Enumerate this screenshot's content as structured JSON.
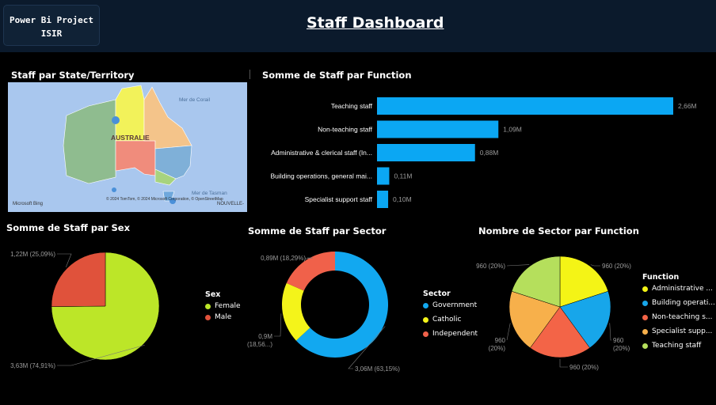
{
  "header": {
    "project_line1": "Power Bi Project",
    "project_line2": "ISIR",
    "title": "Staff Dashboard"
  },
  "map": {
    "title": "Staff par State/Territory",
    "label_australia": "AUSTRALIE",
    "label_coral": "Mer de Corail",
    "label_tasman": "Mer de Tasman",
    "label_nz": "NOUVELLE-",
    "attribution": "© 2024 TomTom, © 2024 Microsoft Corporation, © OpenStreetMap",
    "bing": "Microsoft Bing",
    "colors": {
      "sea": "#a9c7ee",
      "wa": "#8fbc8f",
      "nt": "#f2f25a",
      "sa": "#f08c7c",
      "qld": "#f4c48a",
      "nsw": "#7fb0d8",
      "vic": "#a7d37f",
      "tas": "#6fa8dc"
    }
  },
  "chart_data": [
    {
      "type": "bar",
      "orientation": "horizontal",
      "title": "Somme de Staff par Function",
      "categories": [
        "Teaching staff",
        "Non-teaching staff",
        "Administrative & clerical staff (In...",
        "Building operations, general mai...",
        "Specialist support staff"
      ],
      "values": [
        2.66,
        1.09,
        0.88,
        0.11,
        0.1
      ],
      "data_labels": [
        "2,66M",
        "1,09M",
        "0,88M",
        "0,11M",
        "0,10M"
      ],
      "unit": "M",
      "color": "#0ba7f3"
    },
    {
      "type": "pie",
      "title": "Somme de Staff par Sex",
      "legend_title": "Sex",
      "legend_position": "right",
      "slices": [
        {
          "name": "Female",
          "value": 3.63,
          "label": "3,63M (74,91%)",
          "color": "#bce628"
        },
        {
          "name": "Male",
          "value": 1.22,
          "label": "1,22M (25,09%)",
          "color": "#e0523b"
        }
      ]
    },
    {
      "type": "pie",
      "variant": "donut",
      "title": "Somme de Staff par Sector",
      "legend_title": "Sector",
      "legend_position": "right",
      "slices": [
        {
          "name": "Government",
          "value": 3.06,
          "label": "3,06M (63,15%)",
          "color": "#12a8f0"
        },
        {
          "name": "Catholic",
          "value": 0.9,
          "label": "0,9M (18,56...)",
          "color": "#f4f41a"
        },
        {
          "name": "Independent",
          "value": 0.89,
          "label": "0,89M (18,29%)",
          "color": "#f0614a"
        }
      ]
    },
    {
      "type": "pie",
      "title": "Nombre de Sector par Function",
      "legend_title": "Function",
      "legend_position": "right",
      "slices": [
        {
          "name": "Administrative ...",
          "value": 960,
          "label": "960 (20%)",
          "color": "#f4f416"
        },
        {
          "name": "Building operati...",
          "value": 960,
          "label": "960 (20%)",
          "color": "#17a6ea"
        },
        {
          "name": "Non-teaching s...",
          "value": 960,
          "label": "960 (20%)",
          "color": "#f36447"
        },
        {
          "name": "Specialist supp...",
          "value": 960,
          "label": "960 (20%)",
          "color": "#f7b04b"
        },
        {
          "name": "Teaching staff",
          "value": 960,
          "label": "960 (20%)",
          "color": "#b5df5c"
        }
      ]
    }
  ]
}
